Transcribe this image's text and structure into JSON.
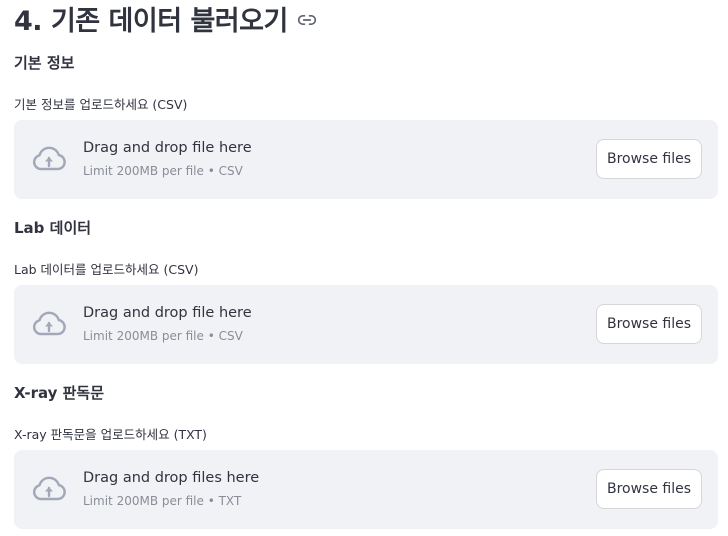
{
  "page": {
    "title": "4. 기존 데이터 불러오기"
  },
  "sections": [
    {
      "heading": "기본 정보",
      "upload_label": "기본 정보를 업로드하세요 (CSV)",
      "drop_text": "Drag and drop file here",
      "limit_text": "Limit 200MB per file • CSV",
      "button_label": "Browse files"
    },
    {
      "heading": "Lab 데이터",
      "upload_label": "Lab 데이터를 업로드하세요 (CSV)",
      "drop_text": "Drag and drop file here",
      "limit_text": "Limit 200MB per file • CSV",
      "button_label": "Browse files"
    },
    {
      "heading": "X-ray 판독문",
      "upload_label": "X-ray 판독문을 업로드하세요 (TXT)",
      "drop_text": "Drag and drop files here",
      "limit_text": "Limit 200MB per file • TXT",
      "button_label": "Browse files"
    }
  ],
  "icons": {
    "title_link": "link-icon",
    "upload": "cloud-upload-icon"
  },
  "colors": {
    "dropzone_bg": "#f0f2f6",
    "icon_color": "#a3a8b8",
    "text": "#31333f",
    "muted_text": "#8a8d97"
  }
}
